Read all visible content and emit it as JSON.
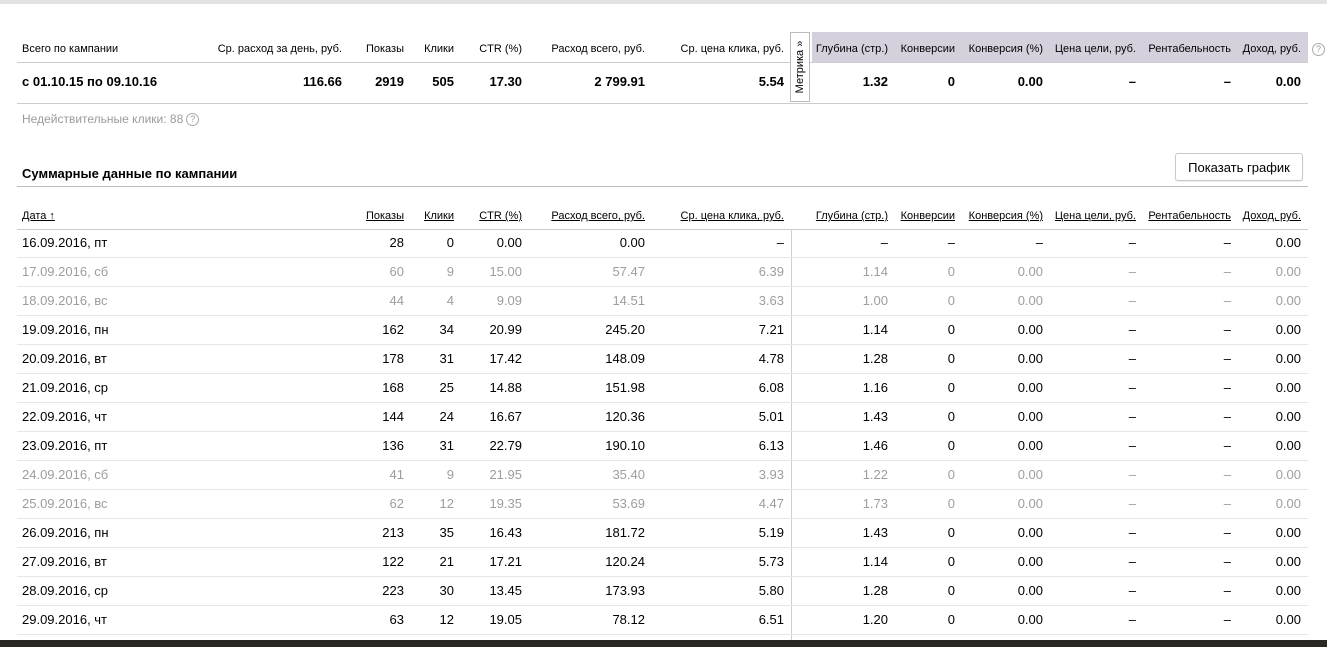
{
  "summary": {
    "headers": {
      "label": "Всего по кампании",
      "avg_daily": "Ср. расход за день, руб.",
      "shows": "Показы",
      "clicks": "Клики",
      "ctr": "CTR (%)",
      "total": "Расход всего, руб.",
      "cpc": "Ср. цена клика, руб.",
      "depth": "Глубина (стр.)",
      "conv": "Конверсии",
      "conv_pct": "Конверсия (%)",
      "goal_price": "Цена цели, руб.",
      "profit": "Рентабельность",
      "income": "Доход, руб."
    },
    "values": {
      "period": "с 01.10.15 по 09.10.16",
      "avg_daily": "116.66",
      "shows": "2919",
      "clicks": "505",
      "ctr": "17.30",
      "total": "2 799.91",
      "cpc": "5.54",
      "depth": "1.32",
      "conv": "0",
      "conv_pct": "0.00",
      "goal_price": "–",
      "profit": "–",
      "income": "0.00"
    },
    "metrika_tab": "Метрика »",
    "invalid_clicks": "Недействительные клики: 88",
    "help_glyph": "?"
  },
  "section": {
    "title": "Суммарные данные по кампании",
    "show_chart_button": "Показать график"
  },
  "table": {
    "headers": {
      "date": "Дата ↑",
      "shows": "Показы",
      "clicks": "Клики",
      "ctr": "CTR (%)",
      "total": "Расход всего, руб.",
      "cpc": "Ср. цена клика, руб.",
      "depth": "Глубина (стр.)",
      "conv": "Конверсии",
      "conv_pct": "Конверсия (%)",
      "goal_price": "Цена цели, руб.",
      "profit": "Рентабельность",
      "income": "Доход, руб."
    },
    "rows": [
      {
        "date": "16.09.2016, пт",
        "shows": "28",
        "clicks": "0",
        "ctr": "0.00",
        "total": "0.00",
        "cpc": "–",
        "depth": "–",
        "conv": "–",
        "conv_pct": "–",
        "goal_price": "–",
        "profit": "–",
        "income": "0.00",
        "dim": false
      },
      {
        "date": "17.09.2016, сб",
        "shows": "60",
        "clicks": "9",
        "ctr": "15.00",
        "total": "57.47",
        "cpc": "6.39",
        "depth": "1.14",
        "conv": "0",
        "conv_pct": "0.00",
        "goal_price": "–",
        "profit": "–",
        "income": "0.00",
        "dim": true
      },
      {
        "date": "18.09.2016, вс",
        "shows": "44",
        "clicks": "4",
        "ctr": "9.09",
        "total": "14.51",
        "cpc": "3.63",
        "depth": "1.00",
        "conv": "0",
        "conv_pct": "0.00",
        "goal_price": "–",
        "profit": "–",
        "income": "0.00",
        "dim": true
      },
      {
        "date": "19.09.2016, пн",
        "shows": "162",
        "clicks": "34",
        "ctr": "20.99",
        "total": "245.20",
        "cpc": "7.21",
        "depth": "1.14",
        "conv": "0",
        "conv_pct": "0.00",
        "goal_price": "–",
        "profit": "–",
        "income": "0.00",
        "dim": false
      },
      {
        "date": "20.09.2016, вт",
        "shows": "178",
        "clicks": "31",
        "ctr": "17.42",
        "total": "148.09",
        "cpc": "4.78",
        "depth": "1.28",
        "conv": "0",
        "conv_pct": "0.00",
        "goal_price": "–",
        "profit": "–",
        "income": "0.00",
        "dim": false
      },
      {
        "date": "21.09.2016, ср",
        "shows": "168",
        "clicks": "25",
        "ctr": "14.88",
        "total": "151.98",
        "cpc": "6.08",
        "depth": "1.16",
        "conv": "0",
        "conv_pct": "0.00",
        "goal_price": "–",
        "profit": "–",
        "income": "0.00",
        "dim": false
      },
      {
        "date": "22.09.2016, чт",
        "shows": "144",
        "clicks": "24",
        "ctr": "16.67",
        "total": "120.36",
        "cpc": "5.01",
        "depth": "1.43",
        "conv": "0",
        "conv_pct": "0.00",
        "goal_price": "–",
        "profit": "–",
        "income": "0.00",
        "dim": false
      },
      {
        "date": "23.09.2016, пт",
        "shows": "136",
        "clicks": "31",
        "ctr": "22.79",
        "total": "190.10",
        "cpc": "6.13",
        "depth": "1.46",
        "conv": "0",
        "conv_pct": "0.00",
        "goal_price": "–",
        "profit": "–",
        "income": "0.00",
        "dim": false
      },
      {
        "date": "24.09.2016, сб",
        "shows": "41",
        "clicks": "9",
        "ctr": "21.95",
        "total": "35.40",
        "cpc": "3.93",
        "depth": "1.22",
        "conv": "0",
        "conv_pct": "0.00",
        "goal_price": "–",
        "profit": "–",
        "income": "0.00",
        "dim": true
      },
      {
        "date": "25.09.2016, вс",
        "shows": "62",
        "clicks": "12",
        "ctr": "19.35",
        "total": "53.69",
        "cpc": "4.47",
        "depth": "1.73",
        "conv": "0",
        "conv_pct": "0.00",
        "goal_price": "–",
        "profit": "–",
        "income": "0.00",
        "dim": true
      },
      {
        "date": "26.09.2016, пн",
        "shows": "213",
        "clicks": "35",
        "ctr": "16.43",
        "total": "181.72",
        "cpc": "5.19",
        "depth": "1.43",
        "conv": "0",
        "conv_pct": "0.00",
        "goal_price": "–",
        "profit": "–",
        "income": "0.00",
        "dim": false
      },
      {
        "date": "27.09.2016, вт",
        "shows": "122",
        "clicks": "21",
        "ctr": "17.21",
        "total": "120.24",
        "cpc": "5.73",
        "depth": "1.14",
        "conv": "0",
        "conv_pct": "0.00",
        "goal_price": "–",
        "profit": "–",
        "income": "0.00",
        "dim": false
      },
      {
        "date": "28.09.2016, ср",
        "shows": "223",
        "clicks": "30",
        "ctr": "13.45",
        "total": "173.93",
        "cpc": "5.80",
        "depth": "1.28",
        "conv": "0",
        "conv_pct": "0.00",
        "goal_price": "–",
        "profit": "–",
        "income": "0.00",
        "dim": false
      },
      {
        "date": "29.09.2016, чт",
        "shows": "63",
        "clicks": "12",
        "ctr": "19.05",
        "total": "78.12",
        "cpc": "6.51",
        "depth": "1.20",
        "conv": "0",
        "conv_pct": "0.00",
        "goal_price": "–",
        "profit": "–",
        "income": "0.00",
        "dim": false
      }
    ]
  },
  "colors": {
    "metrika_header_bg": "#d6d0dd",
    "dim_text": "#9d9d9d"
  }
}
